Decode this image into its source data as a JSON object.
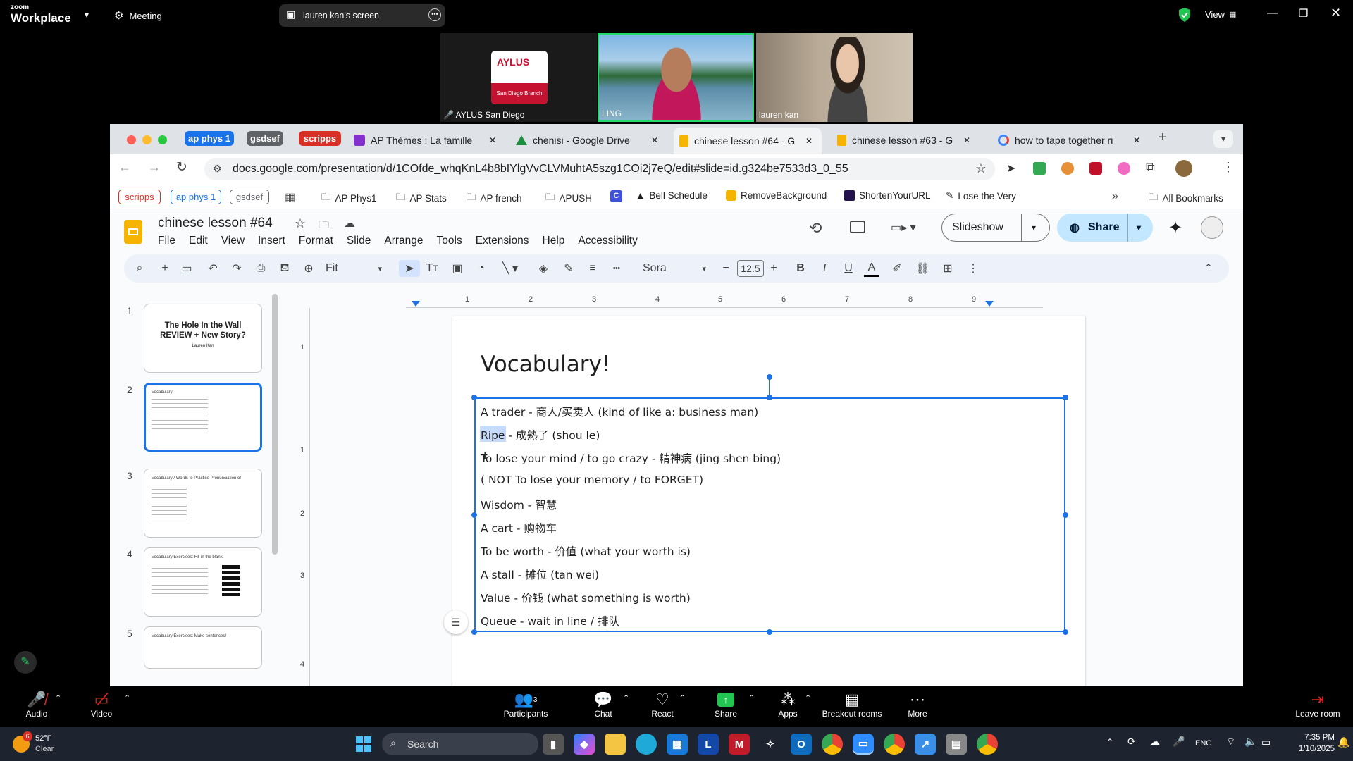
{
  "zoom": {
    "logo_small": "zoom",
    "logo_big": "Workplace",
    "meeting_label": "Meeting",
    "screen_label": "lauren kan's screen",
    "view_label": "View",
    "participants": [
      {
        "name": "AYLUS San Diego",
        "logo_title": "AYLUS",
        "logo_sub": "San Diego Branch",
        "muted": true
      },
      {
        "name": "LING"
      },
      {
        "name": "lauren kan"
      }
    ],
    "bottom": {
      "audio": "Audio",
      "video": "Video",
      "participants": "Participants",
      "participants_count": "3",
      "chat": "Chat",
      "react": "React",
      "share": "Share",
      "apps": "Apps",
      "breakout": "Breakout rooms",
      "more": "More",
      "leave": "Leave room"
    }
  },
  "browser": {
    "tab_groups": [
      {
        "label": "ap phys 1",
        "color": "#1a73e8"
      },
      {
        "label": "gsdsef",
        "color": "#5f6368"
      },
      {
        "label": "scripps",
        "color": "#d93025"
      }
    ],
    "tabs": [
      {
        "label": "AP Thèmes : La famille",
        "icon_color": "#8430ce"
      },
      {
        "label": "chenisi - Google Drive",
        "icon_color": "#1e8e3e"
      },
      {
        "label": "chinese lesson #64 - G",
        "icon_color": "#f4b400",
        "active": true
      },
      {
        "label": "chinese lesson #63 - G",
        "icon_color": "#f4b400"
      },
      {
        "label": "how to tape together ri",
        "icon_color": "#4285f4"
      }
    ],
    "url": "docs.google.com/presentation/d/1COfde_whqKnL4b8bIYlgVvCLVMuhtA5szg1COi2j7eQ/edit#slide=id.g324be7533d3_0_55",
    "bookmarks": {
      "chips": [
        {
          "label": "scripps",
          "color": "#d93025"
        },
        {
          "label": "ap phys 1",
          "color": "#1a73e8"
        },
        {
          "label": "gsdsef",
          "color": "#5f6368"
        }
      ],
      "items": [
        "AP Phys1",
        "AP Stats",
        "AP french",
        "APUSH",
        "Bell Schedule",
        "RemoveBackground",
        "ShortenYourURL",
        "Lose the Very"
      ],
      "all": "All Bookmarks"
    }
  },
  "docs": {
    "title": "chinese lesson #64",
    "menus": [
      "File",
      "Edit",
      "View",
      "Insert",
      "Format",
      "Slide",
      "Arrange",
      "Tools",
      "Extensions",
      "Help",
      "Accessibility"
    ],
    "slideshow": "Slideshow",
    "share": "Share",
    "zoom": "Fit",
    "font": "Sora",
    "font_size": "12.5",
    "ruler_h": [
      "1",
      "2",
      "3",
      "4",
      "5",
      "6",
      "7",
      "8",
      "9"
    ],
    "ruler_v": [
      "1",
      "1",
      "2",
      "3",
      "4"
    ],
    "thumbnails": [
      {
        "num": "1",
        "title": "The Hole In the Wall REVIEW + New Story?",
        "sub": "Lauren Kan"
      },
      {
        "num": "2",
        "title": "Vocabulary!"
      },
      {
        "num": "3",
        "title": "Vocabulary / Words to Practice Pronunciation of"
      },
      {
        "num": "4",
        "title": "Vocabulary Exercises: Fill in the blank!"
      },
      {
        "num": "5",
        "title": "Vocabulary Exercises: Make sentences!"
      }
    ],
    "slide": {
      "heading": "Vocabulary!",
      "items": [
        "A trader - 商人/买卖人 (kind of like a: business man)",
        "Ripe - 成熟了 (shou le)",
        "To lose your mind / to go crazy - 精神病  (jing shen bing)",
        "( NOT To lose your memory / to FORGET)",
        "Wisdom - 智慧",
        "A cart - 购物车",
        "To be worth - 价值 (what your worth is)",
        "A stall - 摊位 (tan wei)",
        "Value - 价钱 (what something is worth)",
        "Queue - wait in line / 排队"
      ]
    }
  },
  "taskbar": {
    "weather_temp": "52°F",
    "weather_desc": "Clear",
    "weather_badge": "6",
    "search": "Search",
    "lang": "ENG",
    "time": "7:35 PM",
    "date": "1/10/2025"
  }
}
